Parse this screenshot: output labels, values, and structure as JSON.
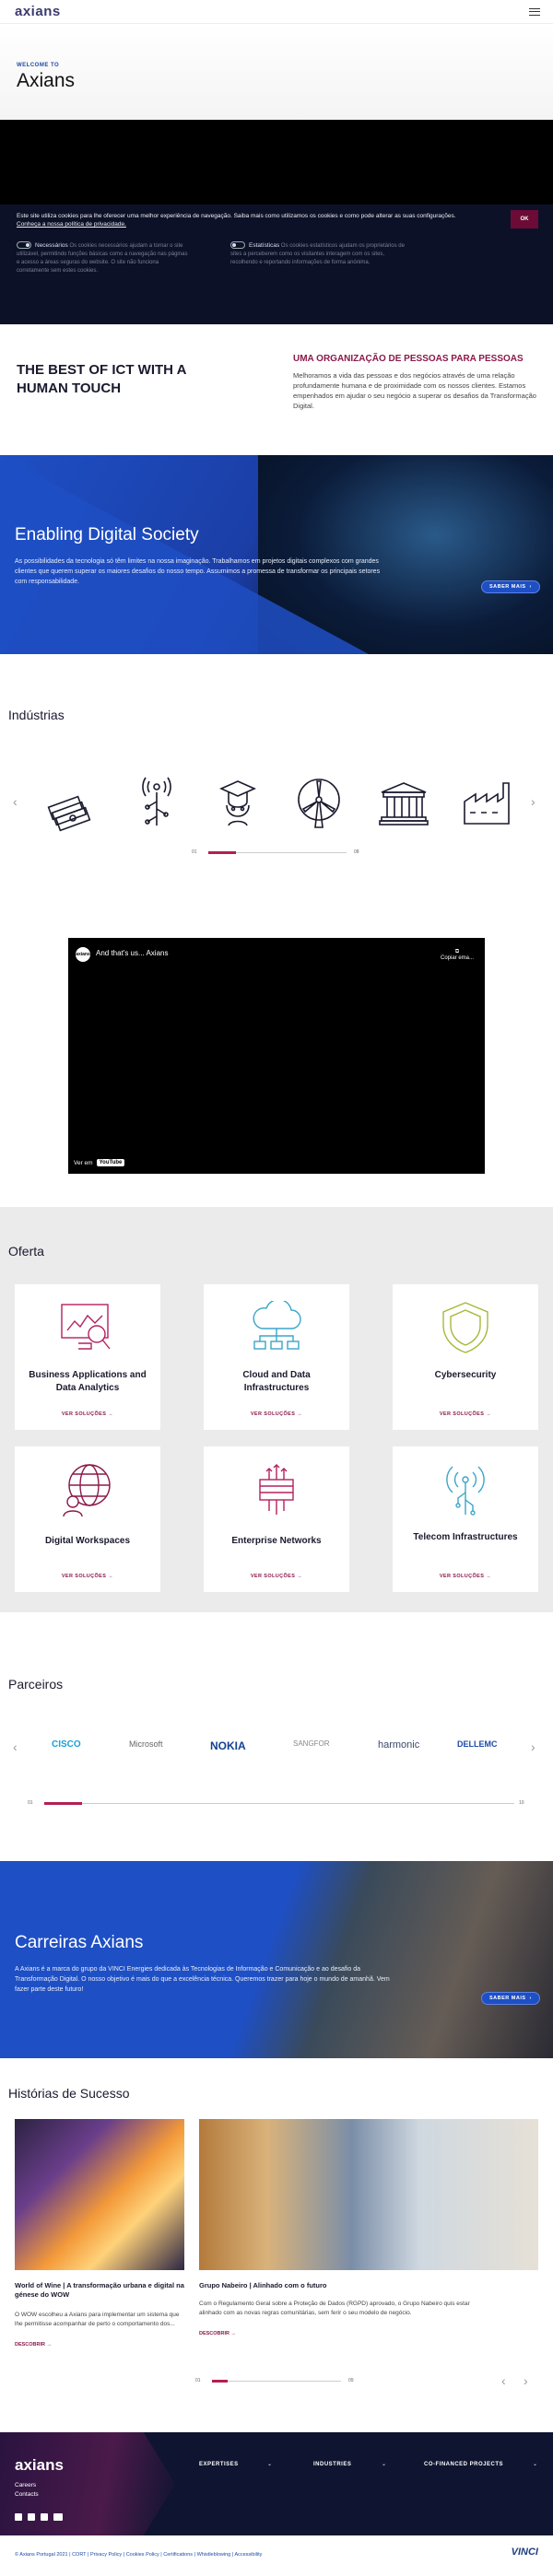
{
  "header": {
    "logo": "axians",
    "menu_icon": "menu-icon"
  },
  "welcome": {
    "eyebrow": "WELCOME TO",
    "title": "Axians"
  },
  "cookies": {
    "text": "Este site utiliza cookies para lhe oferecer uma melhor experiência de navegação. Saiba mais como utilizamos os cookies e como pode alterar as suas configurações.",
    "link": "Conheça a nossa política de privacidade.",
    "ok": "OK",
    "necessary_label": "Necessários",
    "necessary_desc": "Os cookies necessários ajudam a tornar o site utilizável, permitindo funções básicas como a navegação nas páginas e acesso a áreas seguras do website. O site não funciona corretamente sem estes cookies.",
    "stats_label": "Estatísticas",
    "stats_desc": "Os cookies estatísticos ajudam os proprietários de sites a perceberem como os visitantes interagem com os sites, recolhendo e reportando informações de forma anónima."
  },
  "intro": {
    "heading": "THE BEST OF ICT WITH A HUMAN TOUCH",
    "org_title": "UMA ORGANIZAÇÃO DE PESSOAS PARA PESSOAS",
    "org_text": "Melhoramos a vida das pessoas e dos negócios através de uma relação profundamente humana e de proximidade com os nossos clientes. Estamos empenhados em ajudar o seu negócio a superar os desafios da Transformação Digital."
  },
  "digital": {
    "title": "Enabling Digital Society",
    "text": "As possibilidades da tecnologia só têm limites na nossa imaginação. Trabalhamos em projetos digitais complexos com grandes clientes que querem superar os maiores desafios do nosso tempo. Assumimos a promessa de transformar os principais setores com responsabilidade.",
    "button": "SABER MAIS"
  },
  "industrias": {
    "title": "Indústrias",
    "counter_start": "01",
    "counter_end": "08",
    "progress": 0.2
  },
  "video": {
    "title": "And that's us... Axians",
    "avatar": "axians",
    "copy_label": "Copiar ema...",
    "watch_on": "Ver em",
    "youtube": "YouTube"
  },
  "oferta": {
    "title": "Oferta",
    "cards": [
      {
        "title": "Business Applications and Data Analytics",
        "link": "VER SOLUÇÕES",
        "icon": "analytics-icon"
      },
      {
        "title": "Cloud and Data Infrastructures",
        "link": "VER SOLUÇÕES",
        "icon": "cloud-icon"
      },
      {
        "title": "Cybersecurity",
        "link": "VER SOLUÇÕES",
        "icon": "shield-icon"
      },
      {
        "title": "Digital Workspaces",
        "link": "VER SOLUÇÕES",
        "icon": "globe-user-icon"
      },
      {
        "title": "Enterprise Networks",
        "link": "VER SOLUÇÕES",
        "icon": "network-icon"
      },
      {
        "title": "Telecom Infrastructures",
        "link": "VER SOLUÇÕES",
        "icon": "antenna-icon"
      }
    ]
  },
  "parceiros": {
    "title": "Parceiros",
    "logos": [
      "CISCO",
      "Microsoft",
      "NOKIA",
      "SANGFOR",
      "harmonic",
      "DELLEMC"
    ],
    "counter_start": "01",
    "counter_end": "10",
    "progress": 0.08
  },
  "carreiras": {
    "title": "Carreiras Axians",
    "text": "A Axians é a marca do grupo da VINCI Energies dedicada às Tecnologias de Informação e Comunicação e ao desafio da Transformação Digital. O nosso objetivo é mais do que a excelência técnica. Queremos trazer para hoje o mundo de amanhã. Vem fazer parte deste futuro!",
    "button": "SABER MAIS"
  },
  "historias": {
    "title": "Histórias de Sucesso",
    "stories": [
      {
        "title": "World of Wine | A transformação urbana e digital na génese do WOW",
        "desc": "O WOW escolheu a Axians para implementar um sistema que lhe permitisse acompanhar de perto o comportamento dos...",
        "link": "DESCOBRIR"
      },
      {
        "title": "Grupo Nabeiro | Alinhado com o futuro",
        "desc": "Com o Regulamento Geral sobre a Proteção de Dados (RGPD) aprovado, o Grupo Nabeiro quis estar alinhado com as novas regras comunitárias, sem ferir o seu modelo de negócio.",
        "link": "DESCOBRIR"
      }
    ],
    "counter_start": "01",
    "counter_end": "09",
    "progress": 0.12
  },
  "footer": {
    "logo": "axians",
    "links": [
      "Careers",
      "Contacts"
    ],
    "columns": [
      "EXPERTISES",
      "INDUSTRIES",
      "CO-FINANCED PROJECTS"
    ],
    "bottom_links": [
      "© Axians Portugal 2021",
      "CORT",
      "Privacy Policy",
      "Cookies Policy",
      "Certifications",
      "Whistleblowing",
      "Accessibility"
    ],
    "brand": "VINCI"
  }
}
